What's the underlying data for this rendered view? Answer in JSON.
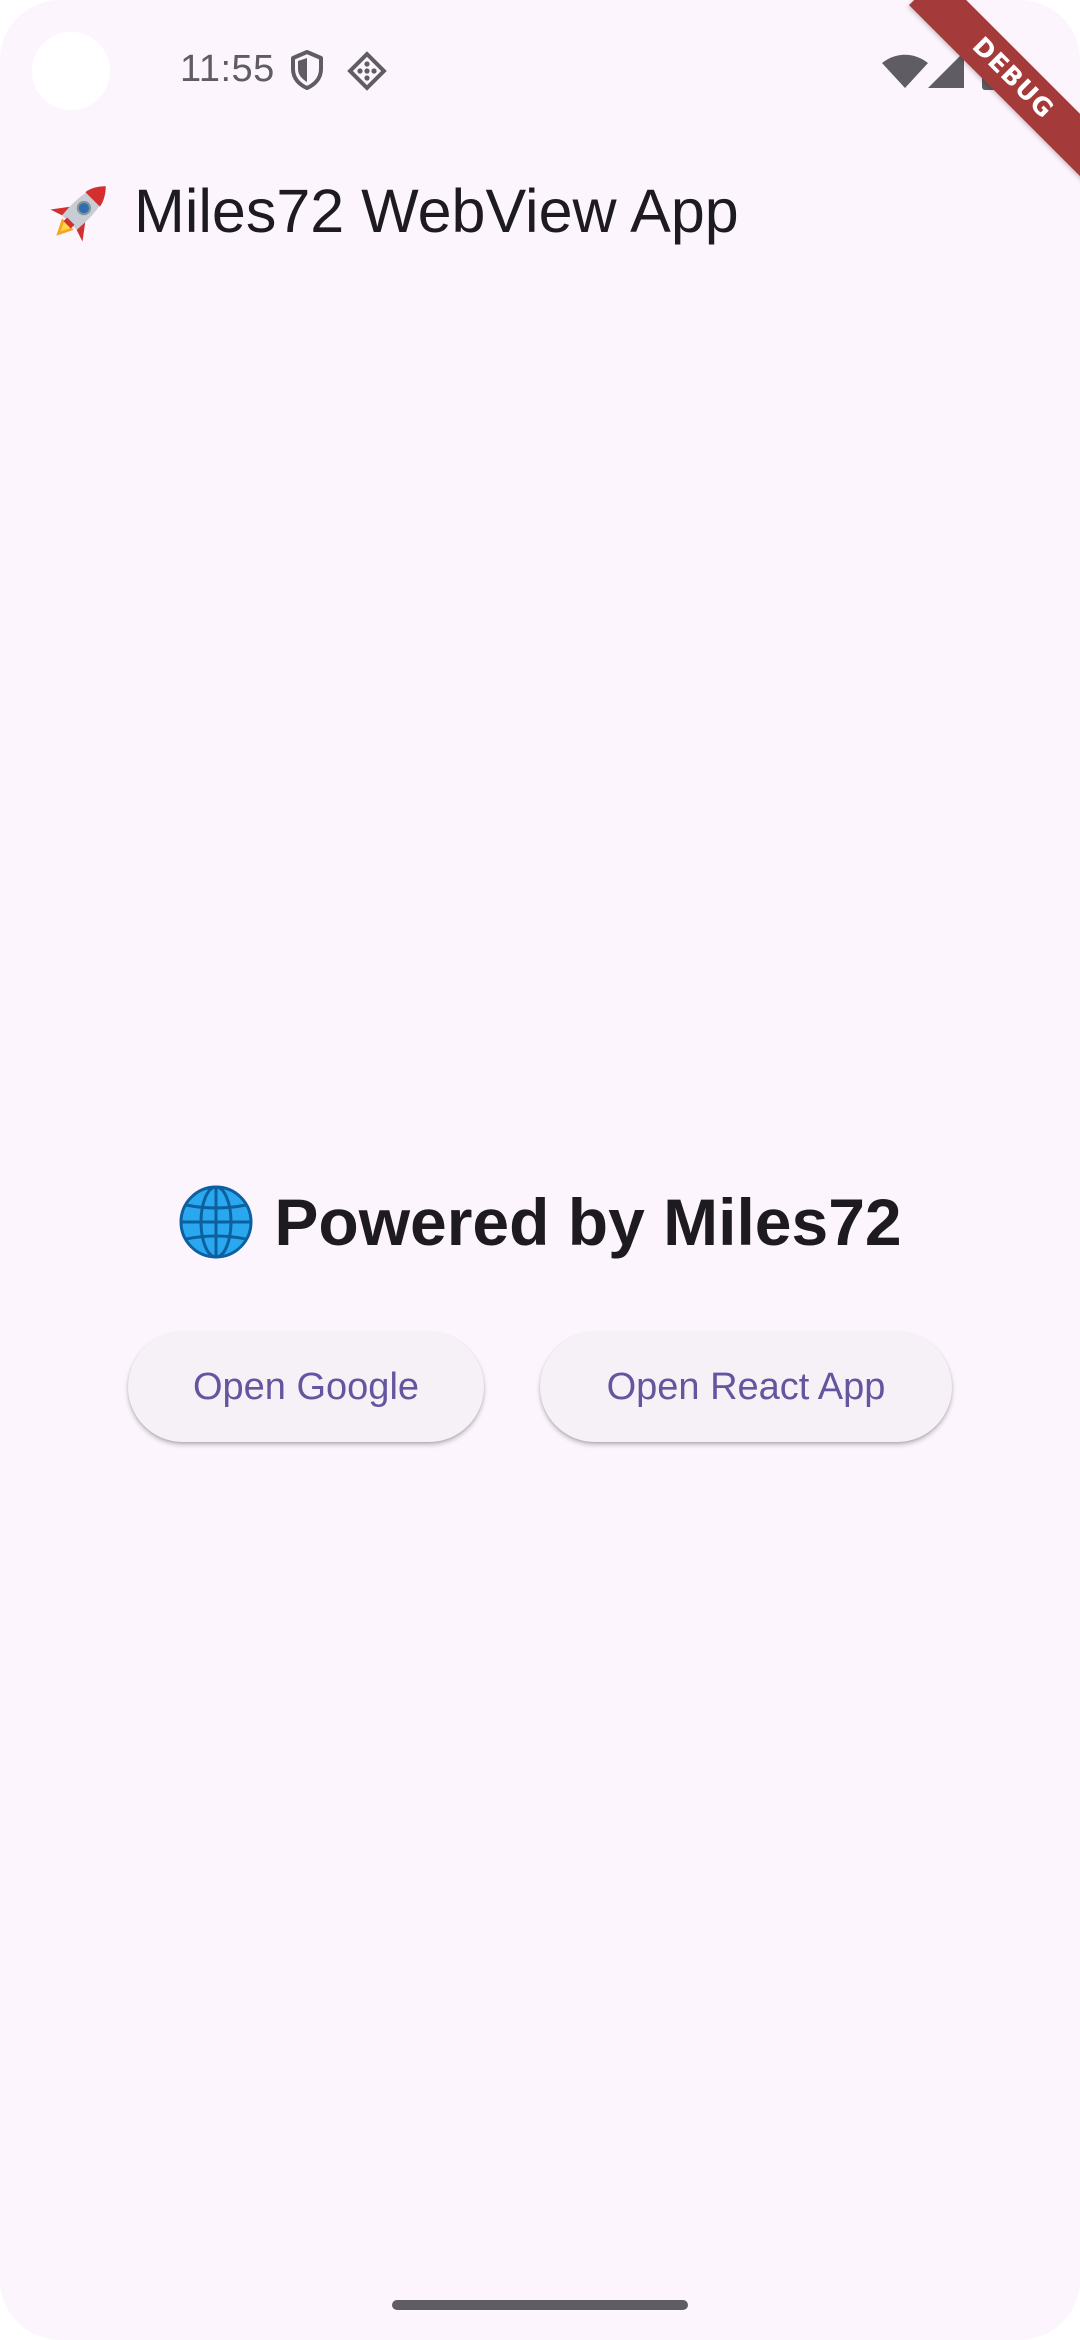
{
  "status_bar": {
    "time": "11:55",
    "icons": [
      "shield-icon",
      "vpn-icon",
      "wifi-icon",
      "cellular-signal-icon",
      "battery-icon"
    ]
  },
  "debug_banner": {
    "label": "DEBUG",
    "color": "#a43a3a"
  },
  "app_bar": {
    "icon": "rocket-icon",
    "title": "Miles72 WebView App"
  },
  "main": {
    "headline_icon": "globe-icon",
    "headline": "Powered by Miles72",
    "buttons": [
      {
        "label": "Open Google"
      },
      {
        "label": "Open React App"
      }
    ]
  },
  "colors": {
    "background": "#fcf5fd",
    "button_background": "#f6f1f7",
    "button_text": "#65559f",
    "text_primary": "#1d1b20",
    "status_icons": "#5f5c63"
  }
}
